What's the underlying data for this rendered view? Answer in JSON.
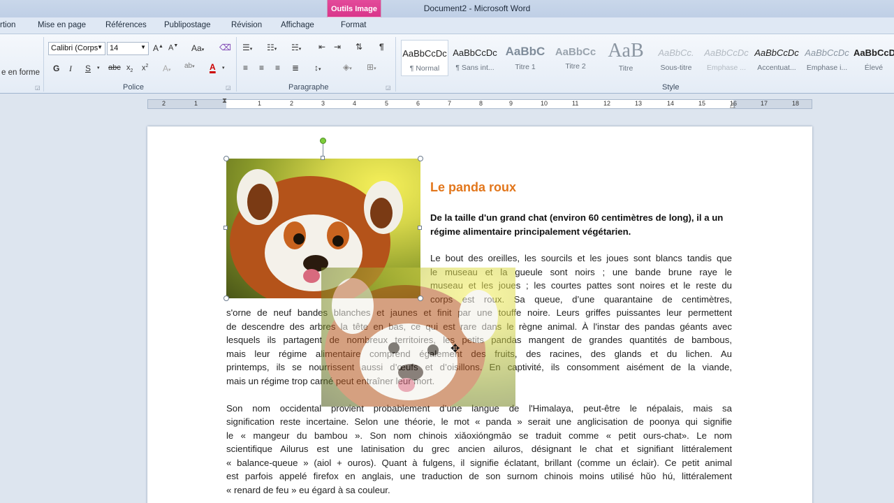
{
  "window": {
    "title": "Document2 - Microsoft Word",
    "context_tab_group": "Outils Image"
  },
  "tabs": [
    "rtion",
    "Mise en page",
    "Références",
    "Publipostage",
    "Révision",
    "Affichage",
    "Format"
  ],
  "ribbon": {
    "left_fragment": "e en forme",
    "font_name": "Calibri (Corps",
    "font_size": "14",
    "group_police": "Police",
    "group_paragraphe": "Paragraphe",
    "group_style": "Style",
    "styles": [
      {
        "sample": "AaBbCcDc",
        "name": "¶ Normal"
      },
      {
        "sample": "AaBbCcDc",
        "name": "¶ Sans int..."
      },
      {
        "sample": "AaBbC",
        "name": "Titre 1"
      },
      {
        "sample": "AaBbCc",
        "name": "Titre 2"
      },
      {
        "sample": "AaB",
        "name": "Titre"
      },
      {
        "sample": "AaBbCc.",
        "name": "Sous-titre"
      },
      {
        "sample": "AaBbCcDc",
        "name": "Emphase ..."
      },
      {
        "sample": "AaBbCcDc",
        "name": "Accentuat..."
      },
      {
        "sample": "AaBbCcDc",
        "name": "Emphase i..."
      },
      {
        "sample": "AaBbCcD",
        "name": "Élevé"
      }
    ],
    "bold_glyph": "G",
    "italic_glyph": "I",
    "underline_glyph": "S"
  },
  "ruler": {
    "numbers": [
      "2",
      "1",
      "1",
      "2",
      "3",
      "4",
      "5",
      "6",
      "7",
      "8",
      "9",
      "10",
      "11",
      "12",
      "13",
      "14",
      "15",
      "16",
      "17",
      "18"
    ]
  },
  "document": {
    "heading": "Le panda roux",
    "lead": "De la taille d'un grand chat (environ 60 centimètres de long), il a un régime alimentaire principalement végétarien.",
    "para1_right": [
      "Le bout des oreilles, les sourcils et les joues sont blancs tandis que",
      "le museau et la gueule sont noirs ; une bande brune raye le",
      "museau et les joues ; les courtes pattes sont noires et le reste du",
      "corps est roux. Sa queue, d’une quarantaine de centimètres,"
    ],
    "para1_full": [
      "s'orne de neuf bandes blanches et jaunes et finit par une touffe noire. Leurs griffes puissantes leur permettent",
      "de descendre des arbres la tête en bas, ce qui est rare dans le règne animal. À l'instar des pandas géants avec",
      "lesquels ils partagent de nombreux territoires, les petits pandas mangent de grandes quantités de bambous,",
      "mais leur régime alimentaire comprend également des fruits, des racines, des glands et du lichen. Au",
      "printemps, ils se nourrissent aussi d’œufs et d’oisillons. En captivité, ils consomment aisément de la viande,"
    ],
    "para1_last": "mais un régime trop carné peut entraîner leur mort.",
    "para2": [
      "Son nom occidental provient probablement d’une langue de l'Himalaya, peut-être le népalais, mais sa",
      "signification reste incertaine. Selon une théorie, le mot « panda » serait une anglicisation de poonya qui signifie",
      "le « mangeur du bambou ». Son nom chinois xiǎoxióngmāo se traduit comme « petit ours-chat». Le nom",
      "scientifique Ailurus est une latinisation du grec ancien ailuros, désignant le chat et signifiant littéralement",
      "« balance-queue » (aiol + ouros). Quant à fulgens, il signifie éclatant, brillant (comme un éclair). Ce petit animal",
      "est parfois appelé firefox en anglais, une traduction de son surnom chinois moins utilisé hǔo hú, littéralement"
    ],
    "para2_last": "« renard de feu » eu égard à sa couleur."
  }
}
